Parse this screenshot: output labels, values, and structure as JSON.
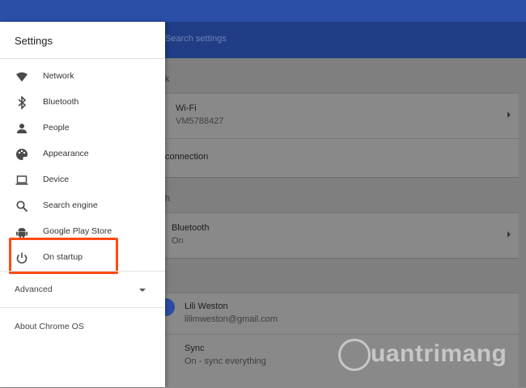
{
  "search": {
    "placeholder": "Search settings"
  },
  "drawer": {
    "title": "Settings",
    "items": [
      {
        "label": "Network",
        "icon": "wifi-icon"
      },
      {
        "label": "Bluetooth",
        "icon": "bluetooth-icon"
      },
      {
        "label": "People",
        "icon": "person-icon"
      },
      {
        "label": "Appearance",
        "icon": "palette-icon"
      },
      {
        "label": "Device",
        "icon": "laptop-icon"
      },
      {
        "label": "Search engine",
        "icon": "search-icon"
      },
      {
        "label": "Google Play Store",
        "icon": "android-icon"
      },
      {
        "label": "On startup",
        "icon": "power-icon"
      }
    ],
    "advanced": "Advanced",
    "about": "About Chrome OS"
  },
  "background": {
    "network_heading_tail": "k",
    "wifi_title": "Wi-Fi",
    "wifi_network": "VM5788427",
    "connection_tail": "connection",
    "bluetooth_heading_tail": "h",
    "bluetooth_title": "Bluetooth",
    "bluetooth_status": "On",
    "person_name": "Lili Weston",
    "person_email": "lilimweston@gmail.com",
    "sync_title": "Sync",
    "sync_status": "On - sync everything"
  },
  "watermark": {
    "text": "uantrimang"
  },
  "colors": {
    "topbar": "#2b4ea7",
    "searchbar": "#203d85",
    "highlight": "#ff4b12",
    "overlay": "#7f7f7f"
  }
}
